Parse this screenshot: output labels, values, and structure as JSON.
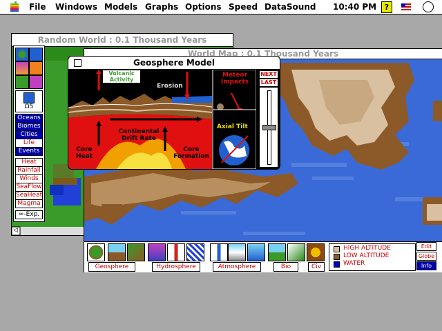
{
  "menubar": {
    "items": [
      "File",
      "Windows",
      "Models",
      "Graphs",
      "Options",
      "Speed",
      "DataSound"
    ],
    "clock": "10:40 PM",
    "help": "?"
  },
  "random_world": {
    "title": "Random World : 0.1 Thousand Years"
  },
  "world_map": {
    "title": "World Map : 0.1 Thousand Years"
  },
  "palette": {
    "omega_label": "Ω5",
    "layers": [
      "Oceans",
      "Biomes",
      "Cities",
      "Life",
      "Events"
    ],
    "selected_layer": "Life",
    "data_layers": [
      "Heat",
      "Rainfall",
      "Winds",
      "SeaFlow",
      "SeaHeat",
      "Magma"
    ],
    "expand_label": "∞-Exp."
  },
  "geosphere_model": {
    "title": "Geosphere Model",
    "labels": {
      "volcanic": "Volcanic Activity",
      "erosion": "Erosion",
      "meteor": "Meteor Impacts",
      "axial_tilt": "Axial Tilt",
      "drift": "Continental Drift Rate",
      "core_heat": "Core Heat",
      "core_formation": "Core Formation"
    },
    "next": "NEXT",
    "last": "LAST"
  },
  "toolbar": {
    "groups": [
      "Geosphere",
      "Hydrosphere",
      "Atmosphere",
      "Bio",
      "Civ"
    ],
    "legend": [
      "HIGH ALTITUDE",
      "LOW ALTITUDE",
      "WATER"
    ],
    "side_buttons": [
      "Edit",
      "Globe",
      "Info"
    ]
  },
  "colors": {
    "high_altitude": "#d8c0a0",
    "low_altitude": "#8c5a28",
    "water": "#3a6ad8",
    "shallow": "#5a86e0",
    "accent_red": "#cc0000"
  }
}
